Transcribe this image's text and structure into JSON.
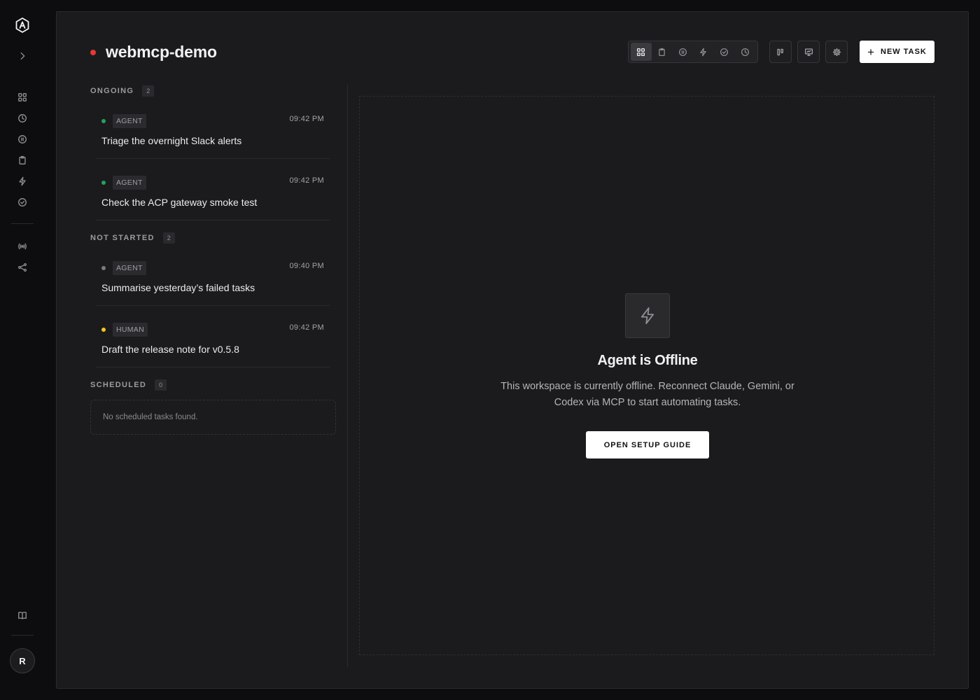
{
  "workspace": {
    "name": "webmcp-demo",
    "status_color": "#e53935"
  },
  "toolbar": {
    "views": [
      "grid-icon",
      "clipboard-icon",
      "pause-circle-icon",
      "bolt-icon",
      "check-circle-icon",
      "clock-icon"
    ],
    "active_view": "grid-icon",
    "new_task_label": "NEW TASK"
  },
  "sections": {
    "ongoing": {
      "title": "ONGOING",
      "count": "2",
      "tasks": [
        {
          "type": "AGENT",
          "time": "09:42 PM",
          "title": "Triage the overnight Slack alerts",
          "dot_color": "#22a35a"
        },
        {
          "type": "AGENT",
          "time": "09:42 PM",
          "title": "Check the ACP gateway smoke test",
          "dot_color": "#22a35a"
        }
      ]
    },
    "not_started": {
      "title": "NOT STARTED",
      "count": "2",
      "tasks": [
        {
          "type": "AGENT",
          "time": "09:40 PM",
          "title": "Summarise yesterday’s failed tasks",
          "dot_color": "#7a7a80"
        },
        {
          "type": "HUMAN",
          "time": "09:42 PM",
          "title": "Draft the release note for v0.5.8",
          "dot_color": "#f5c518"
        }
      ]
    },
    "scheduled": {
      "title": "SCHEDULED",
      "count": "0",
      "empty_text": "No scheduled tasks found."
    }
  },
  "detail": {
    "title": "Agent is Offline",
    "text": "This workspace is currently offline. Reconnect Claude, Gemini, or Codex via MCP to start automating tasks.",
    "button_label": "OPEN SETUP GUIDE"
  },
  "user": {
    "initial": "R"
  }
}
